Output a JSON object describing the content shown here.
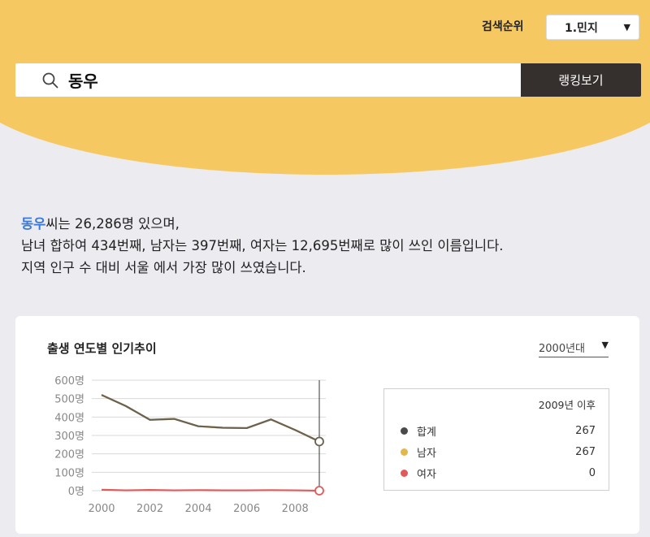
{
  "header": {
    "rank_label": "검색순위",
    "rank_select": "1.민지",
    "search_value": "동우",
    "rank_button": "랭킹보기"
  },
  "summary": {
    "name": "동우",
    "line1_rest": "씨는 26,286명 있으며,",
    "line2": "남녀 합하여 434번째, 남자는 397번째, 여자는 12,695번째로 많이 쓰인 이름입니다.",
    "line3": "지역 인구 수 대비 서울 에서 가장 많이 쓰였습니다."
  },
  "trend": {
    "title": "출생 연도별 인기추이",
    "decade_select": "2000년대",
    "legend": {
      "header": "2009년 이후",
      "items": [
        {
          "label": "합계",
          "value": "267",
          "color": "#4a4a4a"
        },
        {
          "label": "남자",
          "value": "267",
          "color": "#e2b74c"
        },
        {
          "label": "여자",
          "value": "0",
          "color": "#e05a5a"
        }
      ]
    }
  },
  "chart_data": {
    "type": "line",
    "x": [
      2000,
      2001,
      2002,
      2003,
      2004,
      2005,
      2006,
      2007,
      2008,
      2009
    ],
    "series": [
      {
        "name": "합계",
        "color": "#6b6151",
        "values": [
          520,
          460,
          385,
          390,
          350,
          342,
          340,
          387,
          330,
          267
        ]
      },
      {
        "name": "남자",
        "color": "#e2b74c",
        "values": [
          520,
          460,
          385,
          390,
          350,
          342,
          340,
          387,
          330,
          267
        ]
      },
      {
        "name": "여자",
        "color": "#e05a5a",
        "values": [
          5,
          2,
          4,
          2,
          3,
          2,
          2,
          3,
          2,
          0
        ]
      }
    ],
    "xticks": [
      "2000",
      "2002",
      "2004",
      "2006",
      "2008"
    ],
    "yticks": [
      "0명",
      "100명",
      "200명",
      "300명",
      "400명",
      "500명",
      "600명"
    ],
    "ylim": [
      0,
      600
    ],
    "xlim": [
      2000,
      2009
    ],
    "highlight_x": 2009
  }
}
